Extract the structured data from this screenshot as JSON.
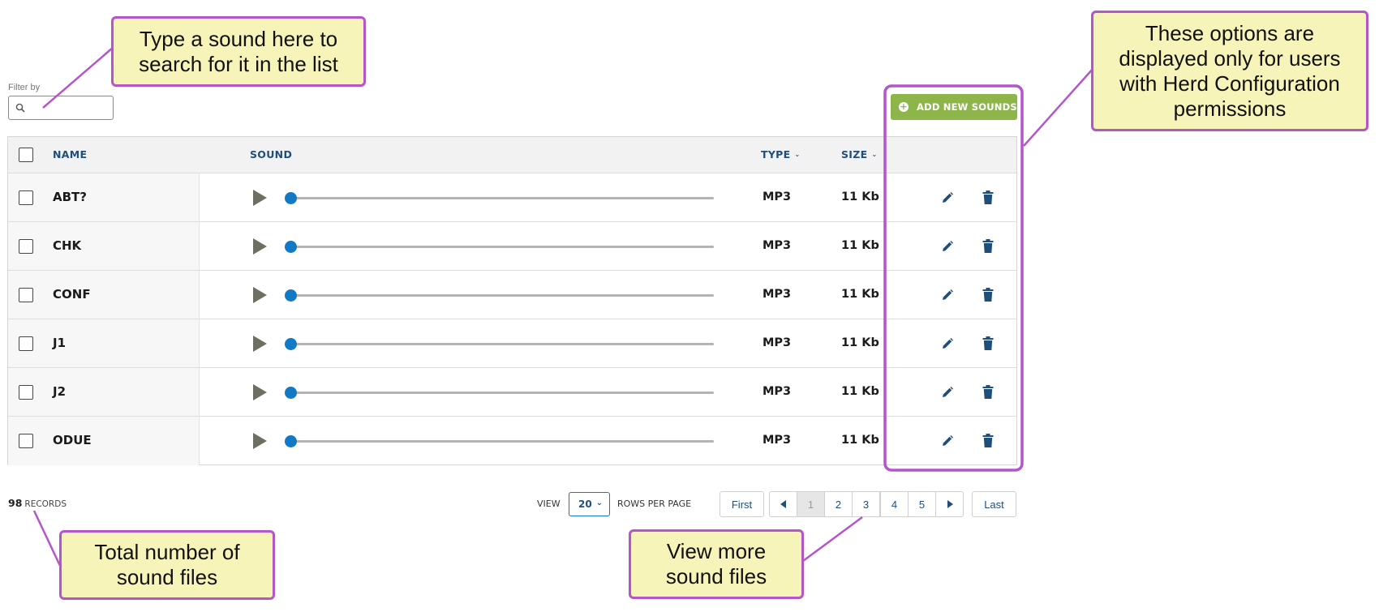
{
  "filter": {
    "label": "Filter by",
    "placeholder": ""
  },
  "toolbar": {
    "add_label": "ADD NEW SOUNDS"
  },
  "table": {
    "headers": {
      "name": "NAME",
      "sound": "SOUND",
      "type": "TYPE",
      "size": "SIZE"
    },
    "rows": [
      {
        "name": "ABT?",
        "type": "MP3",
        "size": "11 Kb",
        "progress": 0
      },
      {
        "name": "CHK",
        "type": "MP3",
        "size": "11 Kb",
        "progress": 0
      },
      {
        "name": "CONF",
        "type": "MP3",
        "size": "11 Kb",
        "progress": 0
      },
      {
        "name": "J1",
        "type": "MP3",
        "size": "11 Kb",
        "progress": 0
      },
      {
        "name": "J2",
        "type": "MP3",
        "size": "11 Kb",
        "progress": 0
      },
      {
        "name": "ODUE",
        "type": "MP3",
        "size": "11 Kb",
        "progress": 0
      }
    ]
  },
  "footer": {
    "records_count": "98",
    "records_label": "RECORDS",
    "view_label": "VIEW",
    "rows_per_page": "20",
    "rows_per_page_label": "ROWS PER PAGE"
  },
  "pagination": {
    "first": "First",
    "last": "Last",
    "pages": [
      "1",
      "2",
      "3",
      "4",
      "5"
    ],
    "current": "1"
  },
  "callouts": {
    "search": [
      "Type a sound here to",
      "search for it in the list"
    ],
    "permissions": [
      "These options are",
      "displayed only for users",
      "with Herd Configuration",
      "permissions"
    ],
    "records": [
      "Total number of",
      "sound files"
    ],
    "more": [
      "View more",
      "sound files"
    ]
  },
  "colors": {
    "accent_blue": "#1279c5",
    "header_text": "#1f4e79",
    "add_button": "#8db54a",
    "callout_fill": "#f6f4b8",
    "callout_border": "#b455cc"
  }
}
